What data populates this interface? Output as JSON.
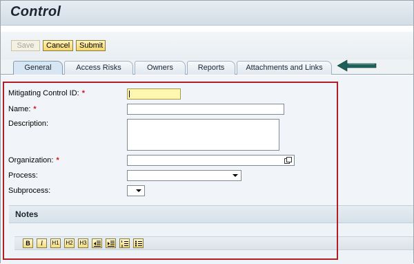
{
  "header": {
    "title": "Control"
  },
  "toolbar": {
    "save_label": "Save",
    "cancel_label": "Cancel",
    "submit_label": "Submit"
  },
  "tabs": [
    {
      "label": "General",
      "active": true
    },
    {
      "label": "Access Risks",
      "active": false
    },
    {
      "label": "Owners",
      "active": false
    },
    {
      "label": "Reports",
      "active": false
    },
    {
      "label": "Attachments and Links",
      "active": false
    }
  ],
  "form": {
    "mitigating_control_id": {
      "label": "Mitigating Control ID:",
      "required": "*",
      "value": ""
    },
    "name": {
      "label": "Name:",
      "required": "*",
      "value": ""
    },
    "description": {
      "label": "Description:",
      "value": ""
    },
    "organization": {
      "label": "Organization:",
      "required": "*",
      "value": ""
    },
    "process": {
      "label": "Process:",
      "value": ""
    },
    "subprocess": {
      "label": "Subprocess:",
      "value": ""
    }
  },
  "notes": {
    "title": "Notes",
    "toolbar": [
      {
        "name": "bold-button",
        "text": "B"
      },
      {
        "name": "italic-button",
        "text": "I"
      },
      {
        "name": "heading1-button",
        "text": "H1"
      },
      {
        "name": "heading2-button",
        "text": "H2"
      },
      {
        "name": "heading3-button",
        "text": "H3"
      },
      {
        "name": "outdent-button",
        "text": ""
      },
      {
        "name": "indent-button",
        "text": ""
      },
      {
        "name": "ordered-list-button",
        "text": ""
      },
      {
        "name": "unordered-list-button",
        "text": ""
      }
    ]
  },
  "colors": {
    "required": "#d0151a",
    "highlight_box": "#b01e24",
    "arrow": "#1f5f5a",
    "button_fill": "#f4d76d"
  },
  "icons": {
    "arrow": "left-arrow-icon",
    "lookup": "value-help-icon",
    "dropdown": "chevron-down-icon"
  }
}
